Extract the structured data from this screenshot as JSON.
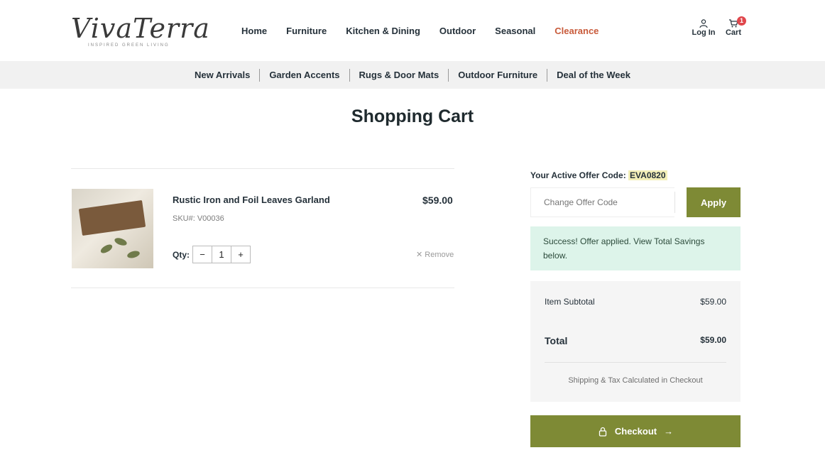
{
  "brand": {
    "logo_text": "VivaTerra",
    "tagline": "INSPIRED GREEN LIVING"
  },
  "nav": {
    "items": [
      {
        "label": "Home"
      },
      {
        "label": "Furniture"
      },
      {
        "label": "Kitchen & Dining"
      },
      {
        "label": "Outdoor"
      },
      {
        "label": "Seasonal"
      },
      {
        "label": "Clearance"
      }
    ],
    "login_label": "Log In",
    "cart_label": "Cart",
    "cart_count": "1"
  },
  "subnav": {
    "items": [
      {
        "label": "New Arrivals"
      },
      {
        "label": "Garden Accents"
      },
      {
        "label": "Rugs & Door Mats"
      },
      {
        "label": "Outdoor Furniture"
      },
      {
        "label": "Deal of the Week"
      }
    ]
  },
  "page": {
    "title": "Shopping Cart"
  },
  "cart_item": {
    "name": "Rustic Iron and Foil Leaves Garland",
    "sku": "SKU#: V00036",
    "price": "$59.00",
    "qty_label": "Qty:",
    "qty_value": "1",
    "minus": "−",
    "plus": "+",
    "remove_label": "✕ Remove"
  },
  "offer": {
    "label": "Your Active Offer Code:",
    "code": "EVA0820",
    "input_placeholder": "Change Offer Code",
    "apply_label": "Apply",
    "success_message": "Success! Offer applied. View Total Savings below."
  },
  "summary": {
    "subtotal_label": "Item Subtotal",
    "subtotal_value": "$59.00",
    "total_label": "Total",
    "total_value": "$59.00",
    "shipping_note": "Shipping & Tax Calculated in Checkout"
  },
  "checkout": {
    "label": "Checkout",
    "arrow": "→"
  },
  "colors": {
    "accent": "#7e8a35",
    "clearance": "#c85a3a",
    "success_bg": "#ddf4ea",
    "badge": "#e0474c"
  }
}
